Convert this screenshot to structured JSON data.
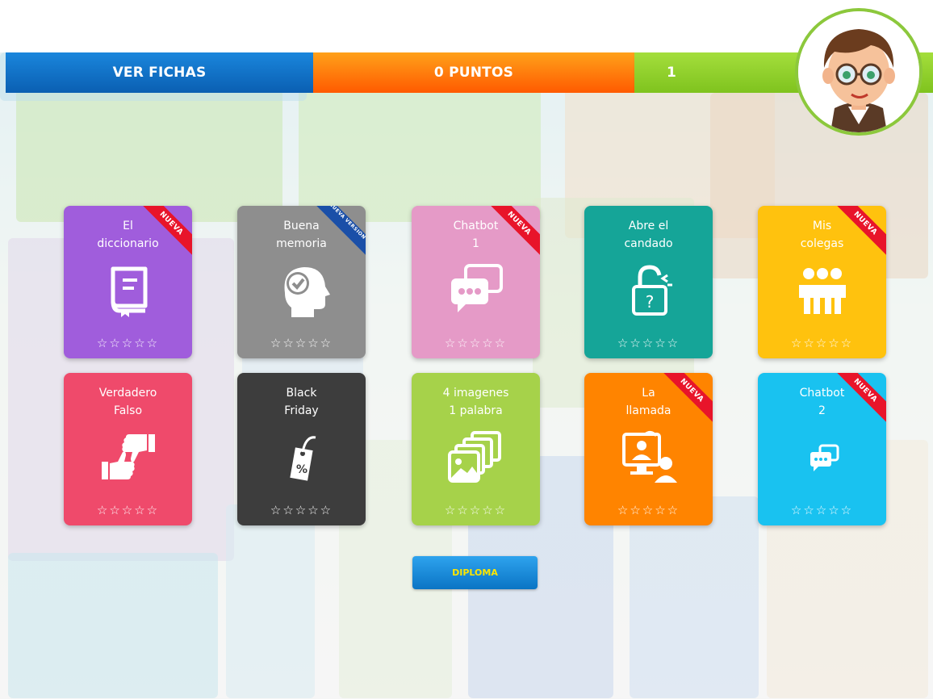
{
  "topbar": {
    "ver_fichas": "VER FICHAS",
    "puntos": "0 PUNTOS",
    "level": "1"
  },
  "cards": [
    {
      "title": "El\ndiccionario",
      "color": "#a05ddc",
      "ribbon": "NUEVA",
      "icon": "dictionary-book-icon"
    },
    {
      "title": "Buena\nmemoria",
      "color": "#8e8e8e",
      "ribbon": "NUEVA VERSION",
      "icon": "head-check-icon"
    },
    {
      "title": "Chatbot\n1",
      "color": "#e59ac7",
      "ribbon": "NUEVA",
      "icon": "chat-bubbles-icon"
    },
    {
      "title": "Abre el\ncandado",
      "color": "#15a598",
      "ribbon": "",
      "icon": "padlock-question-icon"
    },
    {
      "title": "Mis\ncolegas",
      "color": "#ffc20e",
      "ribbon": "NUEVA",
      "icon": "group-friends-icon"
    },
    {
      "title": "Verdadero\nFalso",
      "color": "#ef4a6b",
      "ribbon": "",
      "icon": "thumbs-up-down-icon"
    },
    {
      "title": "Black\nFriday",
      "color": "#3d3d3d",
      "ribbon": "",
      "icon": "price-tag-percent-icon"
    },
    {
      "title": "4 imagenes\n1 palabra",
      "color": "#a6d24a",
      "ribbon": "",
      "icon": "stacked-images-icon"
    },
    {
      "title": "La\nllamada",
      "color": "#ff8400",
      "ribbon": "NUEVA",
      "icon": "video-call-icon"
    },
    {
      "title": "Chatbot\n2",
      "color": "#19c2f0",
      "ribbon": "NUEVA",
      "icon": "chat-bubble-small-icon"
    }
  ],
  "stars": "☆☆☆☆☆",
  "diploma": "DIPLOMA",
  "colors": {
    "blue": "#0a5fb2",
    "orange": "#ff5a00",
    "green": "#8cc83c"
  }
}
